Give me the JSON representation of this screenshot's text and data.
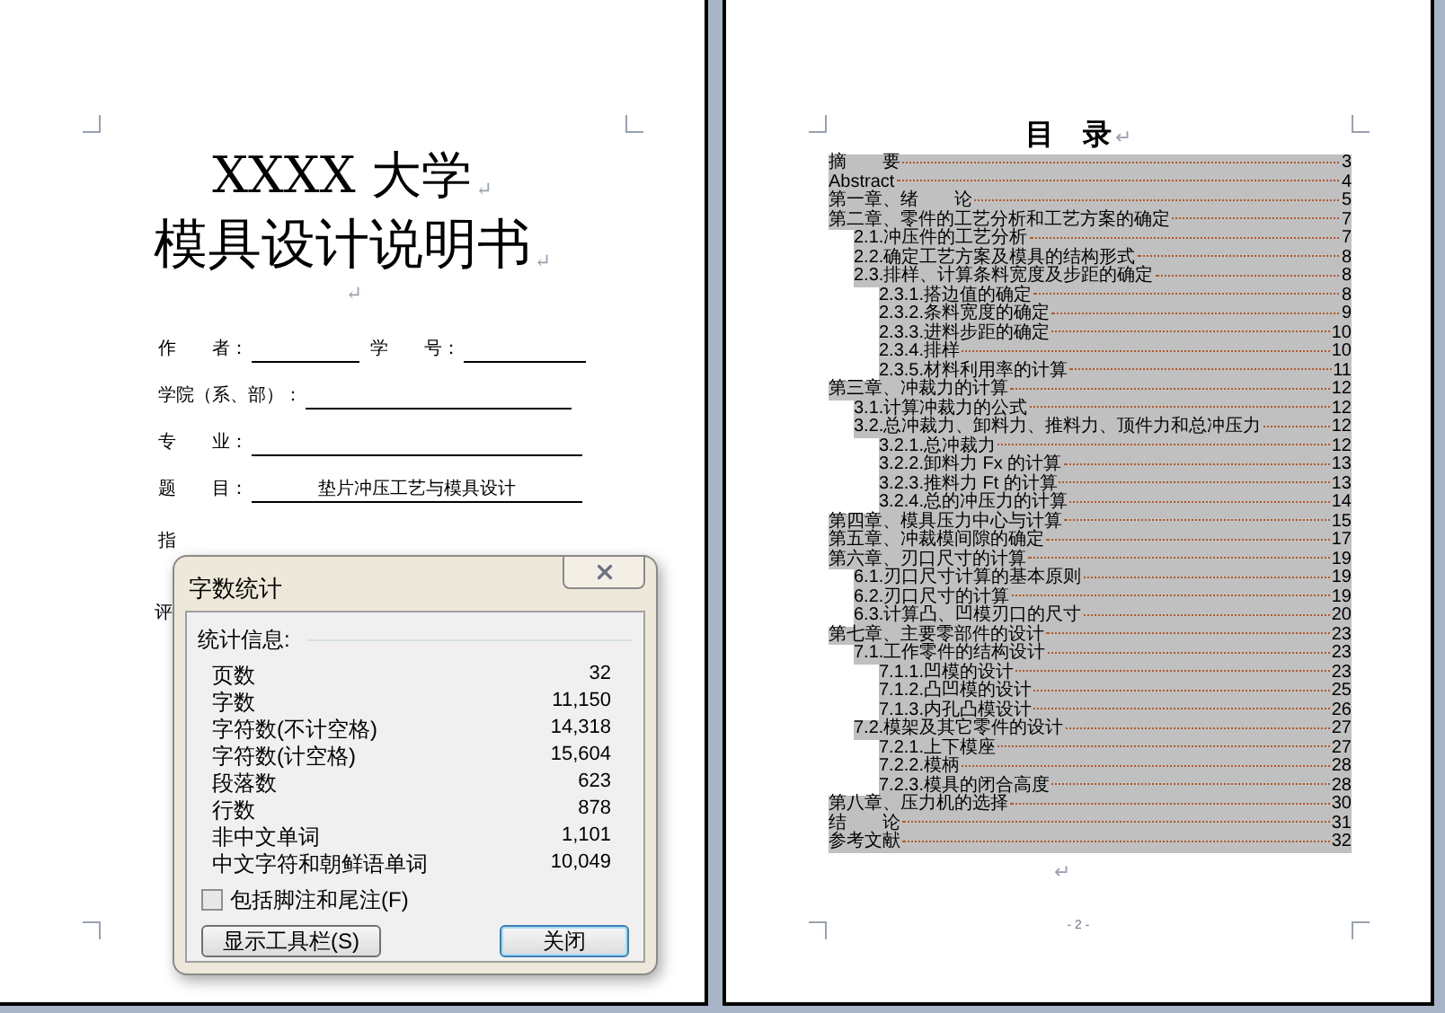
{
  "left_page": {
    "title_lines": [
      {
        "text": "XXXX 大学",
        "mark": "↵"
      },
      {
        "text": "模具设计说明书",
        "mark": "↵"
      }
    ],
    "blank_mark": "↵",
    "form_rows": [
      {
        "fields": [
          {
            "label": "作　　者："
          },
          {
            "label": "学　　号："
          }
        ]
      },
      {
        "fields": [
          {
            "label": "学院（系、部）："
          }
        ]
      },
      {
        "fields": [
          {
            "label": "专　　业："
          }
        ]
      },
      {
        "fields": [
          {
            "label": "题　　目：",
            "value": "垫片冲压工艺与模具设计"
          }
        ]
      }
    ],
    "cut_labels": [
      "指",
      "评"
    ]
  },
  "dialog": {
    "title": "字数统计",
    "group": "统计信息:",
    "stats": [
      {
        "label": "页数",
        "value": "32"
      },
      {
        "label": "字数",
        "value": "11,150"
      },
      {
        "label": "字符数(不计空格)",
        "value": "14,318"
      },
      {
        "label": "字符数(计空格)",
        "value": "15,604"
      },
      {
        "label": "段落数",
        "value": "623"
      },
      {
        "label": "行数",
        "value": "878"
      },
      {
        "label": "非中文单词",
        "value": "1,101"
      },
      {
        "label": "中文字符和朝鲜语单词",
        "value": "10,049"
      }
    ],
    "footnotes": {
      "label": "包括脚注和尾注(F)",
      "checked": false
    },
    "buttons": [
      {
        "label": "显示工具栏(S)",
        "default": false
      },
      {
        "label": "关闭",
        "default": true
      }
    ]
  },
  "right_page": {
    "heading": "目　录",
    "heading_mark": "↵",
    "toc": [
      {
        "title": "摘　　要",
        "page": "3"
      },
      {
        "title": "Abstract",
        "page": "4"
      },
      {
        "title": "第一章、绪　　论",
        "page": "5"
      },
      {
        "title": "第二章、零件的工艺分析和工艺方案的确定",
        "page": "7",
        "children": [
          {
            "title": "2.1.冲压件的工艺分析",
            "page": "7"
          },
          {
            "title": "2.2.确定工艺方案及模具的结构形式",
            "page": "8"
          },
          {
            "title": "2.3.排样、计算条料宽度及步距的确定",
            "page": "8",
            "children": [
              {
                "title": "2.3.1.搭边值的确定",
                "page": "8"
              },
              {
                "title": "2.3.2.条料宽度的确定",
                "page": "9"
              },
              {
                "title": "2.3.3.进料步距的确定",
                "page": "10"
              },
              {
                "title": "2.3.4.排样",
                "page": "10"
              },
              {
                "title": "2.3.5.材料利用率的计算",
                "page": "11"
              }
            ]
          }
        ]
      },
      {
        "title": "第三章、冲裁力的计算",
        "page": "12",
        "children": [
          {
            "title": "3.1.计算冲裁力的公式",
            "page": "12"
          },
          {
            "title": "3.2.总冲裁力、卸料力、推料力、顶件力和总冲压力",
            "page": "12",
            "children": [
              {
                "title": "3.2.1.总冲裁力",
                "page": "12"
              },
              {
                "title": "3.2.2.卸料力 Fx 的计算",
                "page": "13"
              },
              {
                "title": "3.2.3.推料力 Ft 的计算",
                "page": "13"
              },
              {
                "title": "3.2.4.总的冲压力的计算",
                "page": "14"
              }
            ]
          }
        ]
      },
      {
        "title": "第四章、模具压力中心与计算",
        "page": "15"
      },
      {
        "title": "第五章、冲裁模间隙的确定",
        "page": "17"
      },
      {
        "title": "第六章、刃口尺寸的计算",
        "page": "19",
        "children": [
          {
            "title": "6.1.刃口尺寸计算的基本原则",
            "page": "19"
          },
          {
            "title": "6.2.刃口尺寸的计算",
            "page": "19"
          },
          {
            "title": "6.3.计算凸、凹模刃口的尺寸",
            "page": "20"
          }
        ]
      },
      {
        "title": "第七章、主要零部件的设计",
        "page": "23",
        "children": [
          {
            "title": "7.1.工作零件的结构设计",
            "page": "23",
            "children": [
              {
                "title": "7.1.1.凹模的设计",
                "page": "23"
              },
              {
                "title": "7.1.2.凸凹模的设计",
                "page": "25"
              },
              {
                "title": "7.1.3.内孔凸模设计",
                "page": "26"
              }
            ]
          },
          {
            "title": "7.2.模架及其它零件的设计",
            "page": "27",
            "children": [
              {
                "title": "7.2.1.上下模座",
                "page": "27"
              },
              {
                "title": "7.2.2.模柄",
                "page": "28"
              },
              {
                "title": "7.2.3.模具的闭合高度",
                "page": "28"
              }
            ]
          }
        ]
      },
      {
        "title": "第八章、压力机的选择",
        "page": "30"
      },
      {
        "title": "结　　论",
        "page": "31"
      },
      {
        "title": "参考文献",
        "page": "32"
      }
    ],
    "end_mark": "↵",
    "page_number": "- 2 -"
  }
}
